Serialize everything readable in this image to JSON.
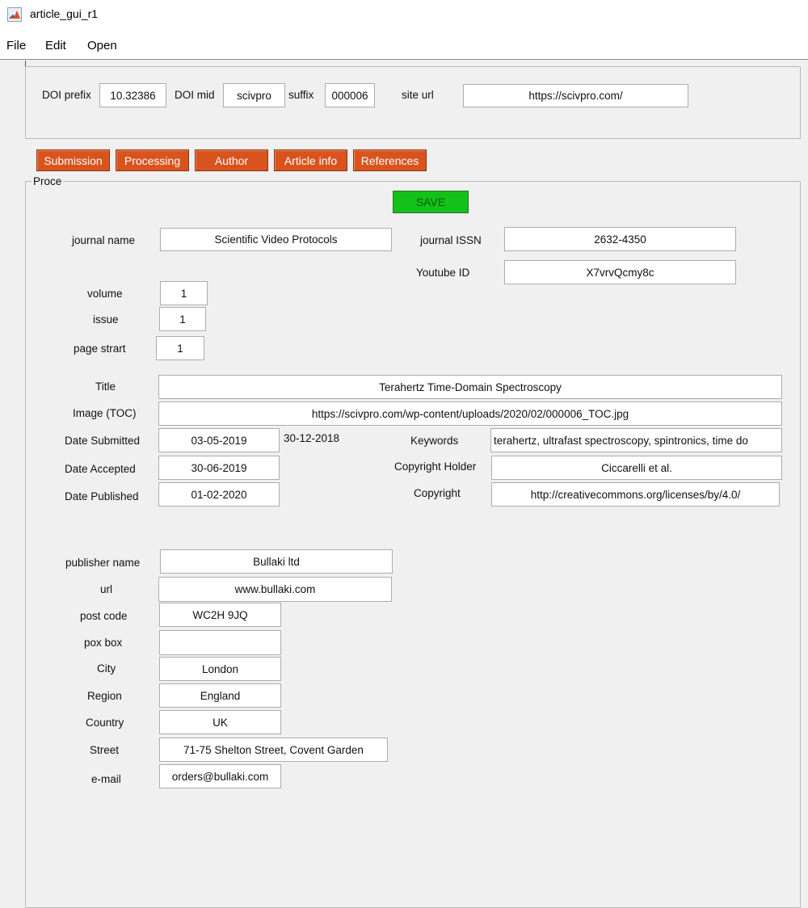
{
  "window": {
    "title": "article_gui_r1"
  },
  "menu": {
    "file": "File",
    "edit": "Edit",
    "open": "Open"
  },
  "doi": {
    "prefix_label": "DOI prefix",
    "prefix_value": "10.32386",
    "mid_label": "DOI mid",
    "mid_value": "scivpro",
    "suffix_label": "suffix",
    "suffix_value": "000006",
    "site_label": "site url",
    "site_value": "https://scivpro.com/"
  },
  "tabs": {
    "submission": "Submission",
    "processing": "Processing",
    "author": "Author",
    "article_info": "Article info",
    "references": "References"
  },
  "group": {
    "title": "Proce"
  },
  "save_label": "SAVE",
  "journal": {
    "name_label": "journal name",
    "name_value": "Scientific Video Protocols",
    "issn_label": "journal ISSN",
    "issn_value": "2632-4350",
    "youtube_label": "Youtube ID",
    "youtube_value": "X7vrvQcmy8c",
    "volume_label": "volume",
    "volume_value": "1",
    "issue_label": "issue",
    "issue_value": "1",
    "page_label": "page strart",
    "page_value": "1"
  },
  "article": {
    "title_label": "Title",
    "title_value": "Terahertz Time-Domain Spectroscopy",
    "image_label": "Image (TOC)",
    "image_value": "https://scivpro.com/wp-content/uploads/2020/02/000006_TOC.jpg",
    "submitted_label": "Date Submitted",
    "submitted_value": "03-05-2019",
    "extra_date": "30-12-2018",
    "accepted_label": "Date Accepted",
    "accepted_value": "30-06-2019",
    "published_label": "Date Published",
    "published_value": "01-02-2020",
    "keywords_label": "Keywords",
    "keywords_value": "terahertz, ultrafast spectroscopy, spintronics, time do",
    "holder_label": "Copyright Holder",
    "holder_value": "Ciccarelli et al.",
    "copyright_label": "Copyright",
    "copyright_value": "http://creativecommons.org/licenses/by/4.0/"
  },
  "publisher": {
    "name_label": "publisher name",
    "name_value": "Bullaki ltd",
    "url_label": "url",
    "url_value": "www.bullaki.com",
    "postcode_label": "post code",
    "postcode_value": "WC2H 9JQ",
    "poxbox_label": "pox box",
    "poxbox_value": "",
    "city_label": "City",
    "city_value": "London",
    "region_label": "Region",
    "region_value": "England",
    "country_label": "Country",
    "country_value": "UK",
    "street_label": "Street",
    "street_value": "71-75 Shelton Street, Covent Garden",
    "email_label": "e-mail",
    "email_value": "orders@bullaki.com"
  },
  "colors": {
    "tab": "#d9531e",
    "save": "#12c218",
    "background": "#f0f0f0"
  },
  "icons": {
    "app": "matlab-icon"
  }
}
